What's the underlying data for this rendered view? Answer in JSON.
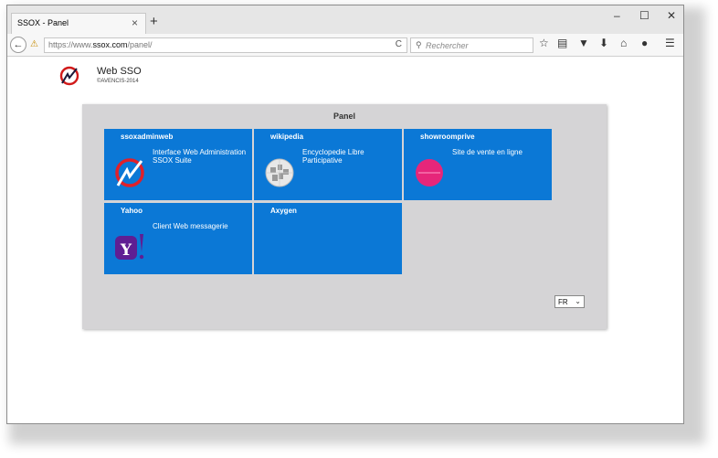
{
  "browser": {
    "tab_title": "SSOX - Panel",
    "tab_close": "×",
    "new_tab": "+",
    "minimize": "–",
    "maximize": "☐",
    "close": "✕",
    "back": "←",
    "url_prefix": "https://www.",
    "url_domain": "ssox.com",
    "url_path": "/panel/",
    "reload": "C",
    "search_placeholder": "Rechercher",
    "toolbar_icons": [
      "star-icon",
      "reading-list-icon",
      "pocket-icon",
      "download-icon",
      "home-icon",
      "chat-icon",
      "menu-icon"
    ]
  },
  "brand": {
    "name": "Web SSO",
    "copyright": "©AVENCIS-2014"
  },
  "panel": {
    "title": "Panel",
    "cards": [
      {
        "name": "ssoxadminweb",
        "description": "Interface Web Administration SSOX Suite",
        "icon": "ssox-logo-icon"
      },
      {
        "name": "wikipedia",
        "description": "Encyclopedie Libre Participative",
        "icon": "wikipedia-globe-icon"
      },
      {
        "name": "showroomprive",
        "description": "Site de vente en ligne",
        "icon": "showroomprive-logo-icon"
      },
      {
        "name": "Yahoo",
        "description": "Client Web messagerie",
        "icon": "yahoo-logo-icon"
      },
      {
        "name": "Axygen",
        "description": "",
        "icon": ""
      }
    ],
    "language": "FR"
  },
  "colors": {
    "card_blue": "#0b78d6",
    "panel_gray": "#d5d4d6",
    "yahoo_purple": "#5f1e93",
    "showroom_pink": "#e6267a"
  }
}
